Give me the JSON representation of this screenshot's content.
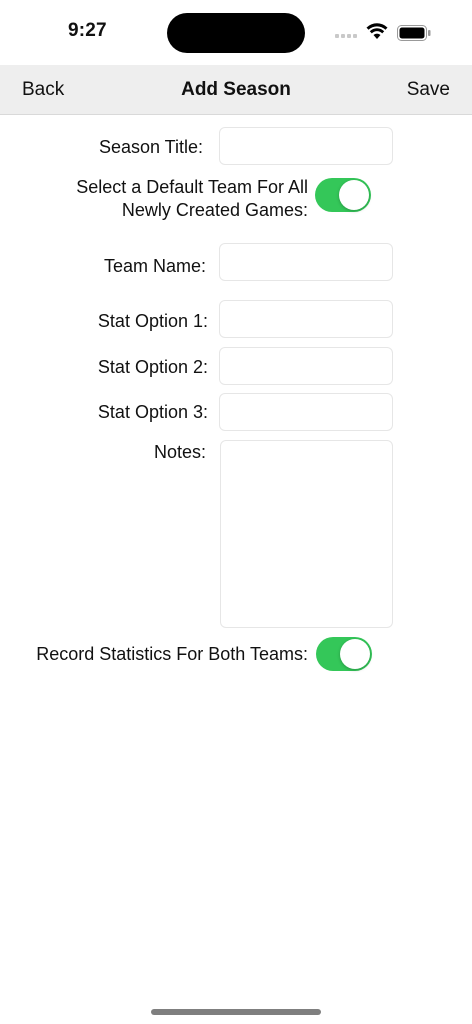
{
  "status": {
    "time": "9:27"
  },
  "navbar": {
    "back_label": "Back",
    "title": "Add Season",
    "save_label": "Save"
  },
  "form": {
    "season_title_label": "Season Title:",
    "season_title_value": "",
    "default_team_label_line1": "Select a Default Team For All",
    "default_team_label_line2": "Newly Created Games:",
    "default_team_toggle_on": true,
    "team_name_label": "Team Name:",
    "team_name_value": "",
    "stat1_label": "Stat Option 1:",
    "stat1_value": "",
    "stat2_label": "Stat Option 2:",
    "stat2_value": "",
    "stat3_label": "Stat Option 3:",
    "stat3_value": "",
    "notes_label": "Notes:",
    "notes_value": "",
    "record_stats_label": "Record Statistics For Both Teams:",
    "record_stats_toggle_on": true
  },
  "colors": {
    "toggle_on": "#34c759",
    "navbar_bg": "#eeeeee"
  }
}
